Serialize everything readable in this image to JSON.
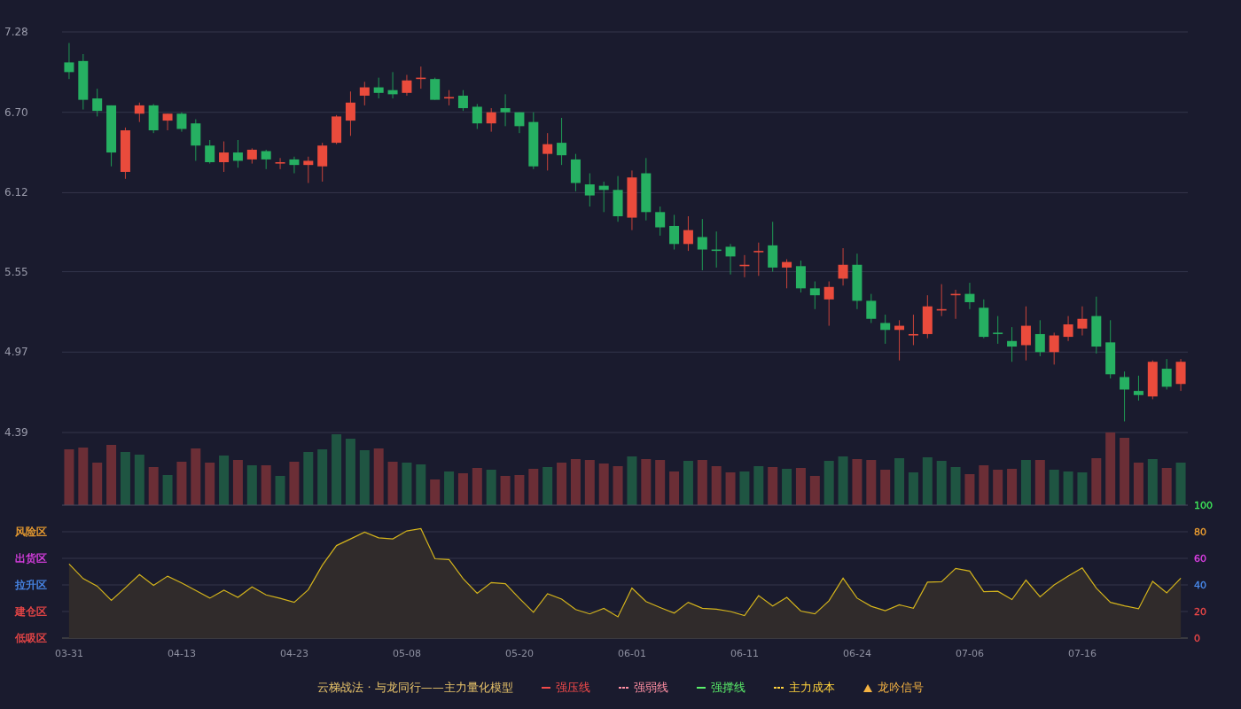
{
  "price_chart": {
    "chart_data": {
      "type": "candlestick",
      "categories": [
        null,
        null,
        null,
        null,
        null,
        null,
        null,
        null,
        null,
        null,
        null,
        null,
        null,
        null,
        null,
        null,
        null,
        null,
        null,
        null,
        null,
        null,
        null,
        null,
        null,
        null,
        null,
        null,
        null,
        null,
        null,
        null,
        null,
        null,
        null,
        null,
        null,
        null,
        null,
        null,
        null,
        null,
        null,
        null,
        null,
        null,
        null,
        null,
        null,
        null,
        null,
        null,
        null,
        null,
        null,
        null,
        null,
        null,
        null,
        null,
        null,
        null,
        null,
        null,
        null,
        null,
        null,
        null,
        null,
        null,
        null,
        null,
        null,
        null,
        null,
        null,
        null,
        null,
        null,
        null
      ],
      "ylim": [
        4.39,
        7.28
      ],
      "yticks": [
        {
          "value": 7.28,
          "label": "7.28"
        },
        {
          "value": 6.7,
          "label": "6.70"
        },
        {
          "value": 6.12,
          "label": "6.12"
        },
        {
          "value": 5.55,
          "label": "5.55"
        },
        {
          "value": 4.97,
          "label": "4.97"
        },
        {
          "value": 4.39,
          "label": "4.39"
        }
      ],
      "grid": true,
      "ohlc": [
        [
          7.06,
          7.2,
          6.94,
          6.99
        ],
        [
          7.07,
          7.12,
          6.72,
          6.79
        ],
        [
          6.8,
          6.87,
          6.67,
          6.71
        ],
        [
          6.75,
          6.75,
          6.31,
          6.41
        ],
        [
          6.27,
          6.59,
          6.22,
          6.57
        ],
        [
          6.69,
          6.77,
          6.63,
          6.75
        ],
        [
          6.75,
          6.76,
          6.55,
          6.57
        ],
        [
          6.64,
          6.69,
          6.57,
          6.69
        ],
        [
          6.69,
          6.7,
          6.56,
          6.58
        ],
        [
          6.62,
          6.65,
          6.35,
          6.46
        ],
        [
          6.46,
          6.5,
          6.33,
          6.34
        ],
        [
          6.34,
          6.49,
          6.27,
          6.41
        ],
        [
          6.41,
          6.5,
          6.3,
          6.35
        ],
        [
          6.36,
          6.44,
          6.33,
          6.43
        ],
        [
          6.42,
          6.43,
          6.29,
          6.36
        ],
        [
          6.33,
          6.37,
          6.29,
          6.34
        ],
        [
          6.36,
          6.38,
          6.26,
          6.32
        ],
        [
          6.32,
          6.38,
          6.19,
          6.35
        ],
        [
          6.31,
          6.48,
          6.2,
          6.46
        ],
        [
          6.48,
          6.68,
          6.47,
          6.67
        ],
        [
          6.64,
          6.85,
          6.53,
          6.77
        ],
        [
          6.82,
          6.92,
          6.75,
          6.88
        ],
        [
          6.88,
          6.95,
          6.8,
          6.84
        ],
        [
          6.86,
          6.99,
          6.8,
          6.83
        ],
        [
          6.84,
          6.97,
          6.82,
          6.93
        ],
        [
          6.94,
          7.03,
          6.87,
          6.95
        ],
        [
          6.94,
          6.95,
          6.79,
          6.79
        ],
        [
          6.8,
          6.86,
          6.75,
          6.81
        ],
        [
          6.82,
          6.86,
          6.71,
          6.73
        ],
        [
          6.74,
          6.76,
          6.58,
          6.62
        ],
        [
          6.62,
          6.73,
          6.56,
          6.7
        ],
        [
          6.73,
          6.83,
          6.6,
          6.7
        ],
        [
          6.7,
          6.7,
          6.55,
          6.6
        ],
        [
          6.63,
          6.7,
          6.29,
          6.31
        ],
        [
          6.4,
          6.55,
          6.28,
          6.47
        ],
        [
          6.48,
          6.66,
          6.32,
          6.39
        ],
        [
          6.36,
          6.4,
          6.13,
          6.19
        ],
        [
          6.18,
          6.26,
          6.02,
          6.1
        ],
        [
          6.17,
          6.2,
          5.98,
          6.14
        ],
        [
          6.14,
          6.24,
          5.91,
          5.95
        ],
        [
          5.94,
          6.28,
          5.85,
          6.23
        ],
        [
          6.26,
          6.37,
          5.92,
          5.98
        ],
        [
          5.98,
          6.02,
          5.81,
          5.87
        ],
        [
          5.88,
          5.96,
          5.71,
          5.75
        ],
        [
          5.75,
          5.95,
          5.7,
          5.85
        ],
        [
          5.8,
          5.93,
          5.56,
          5.71
        ],
        [
          5.71,
          5.84,
          5.58,
          5.7
        ],
        [
          5.73,
          5.75,
          5.53,
          5.66
        ],
        [
          5.59,
          5.67,
          5.51,
          5.6
        ],
        [
          5.69,
          5.76,
          5.52,
          5.7
        ],
        [
          5.74,
          5.91,
          5.55,
          5.58
        ],
        [
          5.58,
          5.64,
          5.43,
          5.62
        ],
        [
          5.59,
          5.63,
          5.4,
          5.43
        ],
        [
          5.43,
          5.48,
          5.28,
          5.38
        ],
        [
          5.35,
          5.48,
          5.16,
          5.44
        ],
        [
          5.5,
          5.72,
          5.45,
          5.6
        ],
        [
          5.6,
          5.68,
          5.28,
          5.34
        ],
        [
          5.34,
          5.39,
          5.18,
          5.21
        ],
        [
          5.18,
          5.24,
          5.03,
          5.13
        ],
        [
          5.13,
          5.2,
          4.91,
          5.16
        ],
        [
          5.09,
          5.24,
          5.02,
          5.1
        ],
        [
          5.1,
          5.38,
          5.07,
          5.3
        ],
        [
          5.27,
          5.46,
          5.23,
          5.28
        ],
        [
          5.38,
          5.42,
          5.21,
          5.39
        ],
        [
          5.39,
          5.47,
          5.28,
          5.33
        ],
        [
          5.29,
          5.35,
          5.07,
          5.08
        ],
        [
          5.11,
          5.23,
          5.03,
          5.1
        ],
        [
          5.05,
          5.15,
          4.9,
          5.01
        ],
        [
          5.02,
          5.3,
          4.91,
          5.16
        ],
        [
          5.1,
          5.2,
          4.94,
          4.97
        ],
        [
          4.97,
          5.11,
          4.88,
          5.09
        ],
        [
          5.08,
          5.23,
          5.05,
          5.17
        ],
        [
          5.14,
          5.3,
          5.09,
          5.21
        ],
        [
          5.23,
          5.37,
          4.96,
          5.01
        ],
        [
          5.04,
          5.2,
          4.78,
          4.81
        ],
        [
          4.79,
          4.83,
          4.47,
          4.7
        ],
        [
          4.69,
          4.8,
          4.62,
          4.66
        ],
        [
          4.65,
          4.91,
          4.63,
          4.9
        ],
        [
          4.85,
          4.92,
          4.7,
          4.72
        ],
        [
          4.74,
          4.92,
          4.69,
          4.9
        ]
      ]
    }
  },
  "indicator": {
    "zones": [
      {
        "label": "风险区",
        "color": "#f0a030"
      },
      {
        "label": "出货区",
        "color": "#e040e8"
      },
      {
        "label": "拉升区",
        "color": "#4a8cf0"
      },
      {
        "label": "建仓区",
        "color": "#f04848"
      },
      {
        "label": "低吸区",
        "color": "#f04848"
      }
    ],
    "right_ticks": [
      {
        "label": "100",
        "color": "#3ee85a"
      },
      {
        "label": "80",
        "color": "#f0a030"
      },
      {
        "label": "60",
        "color": "#e040e8"
      },
      {
        "label": "40",
        "color": "#4a8cf0"
      },
      {
        "label": "20",
        "color": "#f04848"
      },
      {
        "label": "0",
        "color": "#f04848"
      }
    ],
    "chart_data": {
      "type": "area",
      "categories": [
        "03-31",
        null,
        null,
        null,
        null,
        null,
        null,
        null,
        "04-13",
        null,
        null,
        null,
        null,
        null,
        null,
        null,
        "04-23",
        null,
        null,
        null,
        null,
        null,
        null,
        null,
        "05-08",
        null,
        null,
        null,
        null,
        null,
        null,
        null,
        "05-20",
        null,
        null,
        null,
        null,
        null,
        null,
        null,
        "06-01",
        null,
        null,
        null,
        null,
        null,
        null,
        null,
        "06-11",
        null,
        null,
        null,
        null,
        null,
        null,
        null,
        "06-24",
        null,
        null,
        null,
        null,
        null,
        null,
        null,
        "07-06",
        null,
        null,
        null,
        null,
        null,
        null,
        null,
        "07-16",
        null,
        null,
        null,
        null,
        null,
        null,
        null
      ],
      "series": [
        {
          "color": "#d4b41c",
          "values": [
            55.8,
            44.8,
            39.1,
            28.4,
            37.9,
            47.8,
            39.7,
            46.6,
            41.5,
            35.8,
            30.1,
            36.1,
            30.7,
            38.5,
            32.5,
            29.9,
            26.9,
            36.4,
            54.9,
            69.6,
            74.6,
            79.7,
            75.5,
            74.6,
            80.6,
            82.4,
            59.7,
            59.1,
            44.8,
            33.7,
            41.8,
            40.9,
            29.9,
            19.4,
            33.4,
            29.3,
            21.5,
            18.2,
            22.4,
            16.1,
            37.6,
            27.5,
            23,
            18.8,
            26.9,
            22.4,
            21.8,
            20,
            17,
            31.9,
            24.2,
            30.7,
            20.3,
            18.2,
            28.1,
            45.1,
            30.1,
            23.9,
            20.6,
            25.1,
            22.4,
            42.1,
            42.4,
            52.5,
            50.4,
            34.9,
            35.2,
            29,
            43.6,
            31,
            40,
            46.6,
            52.8,
            37.6,
            26.9,
            24.2,
            22.1,
            42.7,
            34,
            45.1
          ]
        }
      ],
      "ylim": [
        0,
        100
      ],
      "yticks": [
        100,
        80,
        60,
        40,
        20,
        0
      ],
      "grid": true
    }
  },
  "legend": {
    "title": "云梯战法 · 与龙同行——主力量化模型",
    "items": [
      {
        "kind": "solid",
        "label": "强压线",
        "color": "#f24a4a"
      },
      {
        "kind": "dashed",
        "label": "强弱线",
        "color": "#ff8fa3"
      },
      {
        "kind": "solid",
        "label": "强撑线",
        "color": "#5af06a"
      },
      {
        "kind": "dashed",
        "label": "主力成本",
        "color": "#ffd23c"
      },
      {
        "kind": "triangle",
        "label": "龙吟信号",
        "color": "#f5b342"
      }
    ]
  }
}
